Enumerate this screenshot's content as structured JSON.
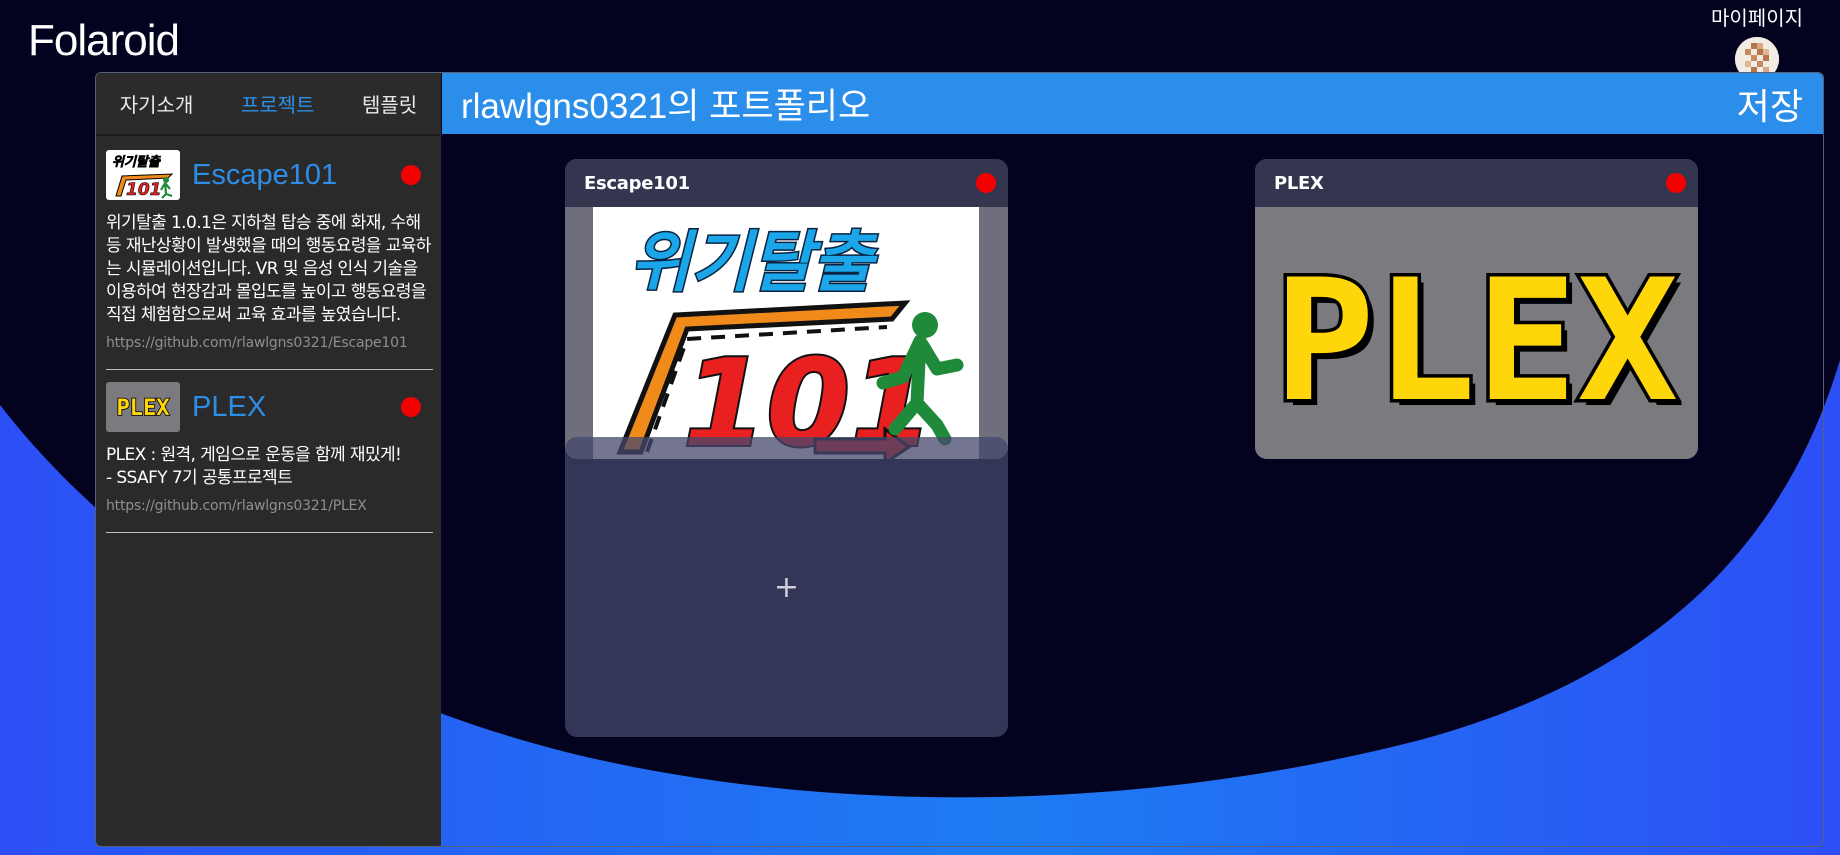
{
  "app": {
    "logo": "Folaroid"
  },
  "header": {
    "mypage_label": "마이페이지"
  },
  "sidebar": {
    "tabs": [
      {
        "label": "자기소개",
        "active": false
      },
      {
        "label": "프로젝트",
        "active": true
      },
      {
        "label": "템플릿",
        "active": false
      }
    ],
    "projects": [
      {
        "title": "Escape101",
        "description": "위기탈출 1.0.1은 지하철 탑승 중에 화재, 수해 등 재난상황이 발생했을 때의 행동요령을 교육하는 시뮬레이션입니다. VR 및 음성 인식 기술을 이용하여 현장감과 몰입도를 높이고 행동요령을 직접 체험함으로써 교육 효과를 높였습니다.",
        "link": "https://github.com/rlawlgns0321/Escape101"
      },
      {
        "title": "PLEX",
        "description": "PLEX : 원격, 게임으로 운동을 함께 재밌게!\n- SSAFY 7기 공통프로젝트",
        "link": "https://github.com/rlawlgns0321/PLEX"
      }
    ]
  },
  "main": {
    "title": "rlawlgns0321의 포트폴리오",
    "save_label": "저장",
    "cards": [
      {
        "title": "Escape101",
        "image_text_top": "위기탈출",
        "image_text_bottom": "101"
      },
      {
        "title": "PLEX",
        "image_text": "PLEX"
      }
    ],
    "add_label": "+"
  },
  "colors": {
    "accent": "#2b8eea",
    "status_dot": "#f30000",
    "background": "#03031f",
    "wave": "#2e55f5"
  }
}
